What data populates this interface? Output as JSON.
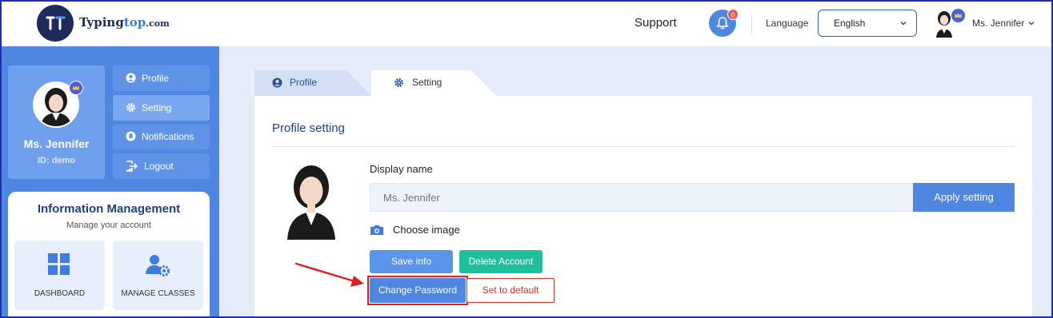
{
  "brand": {
    "logo_main": "Typing",
    "logo_accent": "top",
    "logo_domain": ".com"
  },
  "header": {
    "support_label": "Support",
    "notification_count": "0",
    "language_label": "Language",
    "language_value": "English",
    "user_name": "Ms. Jennifer"
  },
  "sidebar": {
    "profile_name": "Ms. Jennifer",
    "profile_id": "ID: demo",
    "nav": [
      {
        "label": "Profile",
        "icon": "user-circle-icon"
      },
      {
        "label": "Setting",
        "icon": "gear-icon"
      },
      {
        "label": "Notifications",
        "icon": "bell-icon"
      },
      {
        "label": "Logout",
        "icon": "logout-icon"
      }
    ],
    "info_title": "Information Management",
    "info_subtitle": "Manage your account",
    "tiles": [
      {
        "label": "DASHBOARD",
        "icon": "dashboard-grid-icon"
      },
      {
        "label": "MANAGE CLASSES",
        "icon": "user-settings-icon"
      }
    ]
  },
  "tabs": [
    {
      "label": "Profile",
      "icon": "user-circle-icon"
    },
    {
      "label": "Setting",
      "icon": "gear-icon"
    }
  ],
  "settings": {
    "title": "Profile setting",
    "display_name_label": "Display name",
    "display_name_placeholder": "Ms. Jennifer",
    "apply_label": "Apply setting",
    "choose_image_label": "Choose image",
    "save_label": "Save info",
    "delete_label": "Delete Account",
    "change_password_label": "Change Password",
    "set_default_label": "Set to default"
  },
  "colors": {
    "primary": "#4e86e2",
    "brand_dark": "#1e2a5c",
    "danger": "#d03030",
    "success": "#1fbf9e",
    "annotation": "#e02020"
  }
}
